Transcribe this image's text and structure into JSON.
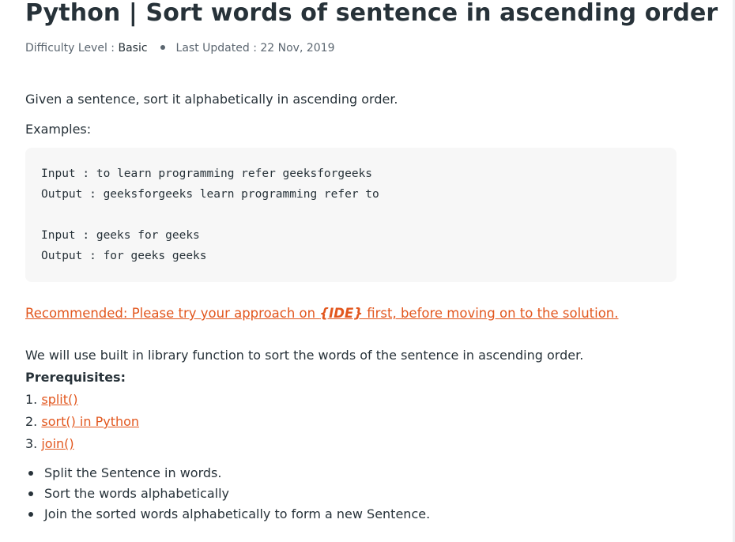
{
  "article": {
    "title": "Python | Sort words of sentence in ascending order",
    "meta": {
      "difficulty_label": "Difficulty Level : ",
      "difficulty_value": "Basic",
      "updated_label": "Last Updated : ",
      "updated_value": "22 Nov, 2019"
    },
    "intro": "Given a sentence, sort it alphabetically in ascending order.",
    "examples_label": "Examples:",
    "code_lines": [
      "Input : to learn programming refer geeksforgeeks",
      "Output : geeksforgeeks learn programming refer to",
      "Input : geeks for geeks",
      "Output : for geeks geeks"
    ],
    "recommended": {
      "prefix": "Recommended: Please try your approach on ",
      "ide": "{IDE}",
      "suffix": " first, before moving on to the solution."
    },
    "approach": "We will use built in library function to sort the words of the sentence in ascending order.",
    "prereq_label": "Prerequisites:",
    "prereqs": [
      {
        "num": "1. ",
        "link": "split()"
      },
      {
        "num": "2. ",
        "link": "sort() in Python"
      },
      {
        "num": "3. ",
        "link": "join()"
      }
    ],
    "steps": [
      "Split the Sentence in words.",
      "Sort the words alphabetically",
      "Join the sorted words alphabetically to form a new Sentence."
    ]
  },
  "colors": {
    "text": "#273239",
    "muted": "#5b6670",
    "link": "#e2571e",
    "code_bg": "#f7f7f7"
  }
}
